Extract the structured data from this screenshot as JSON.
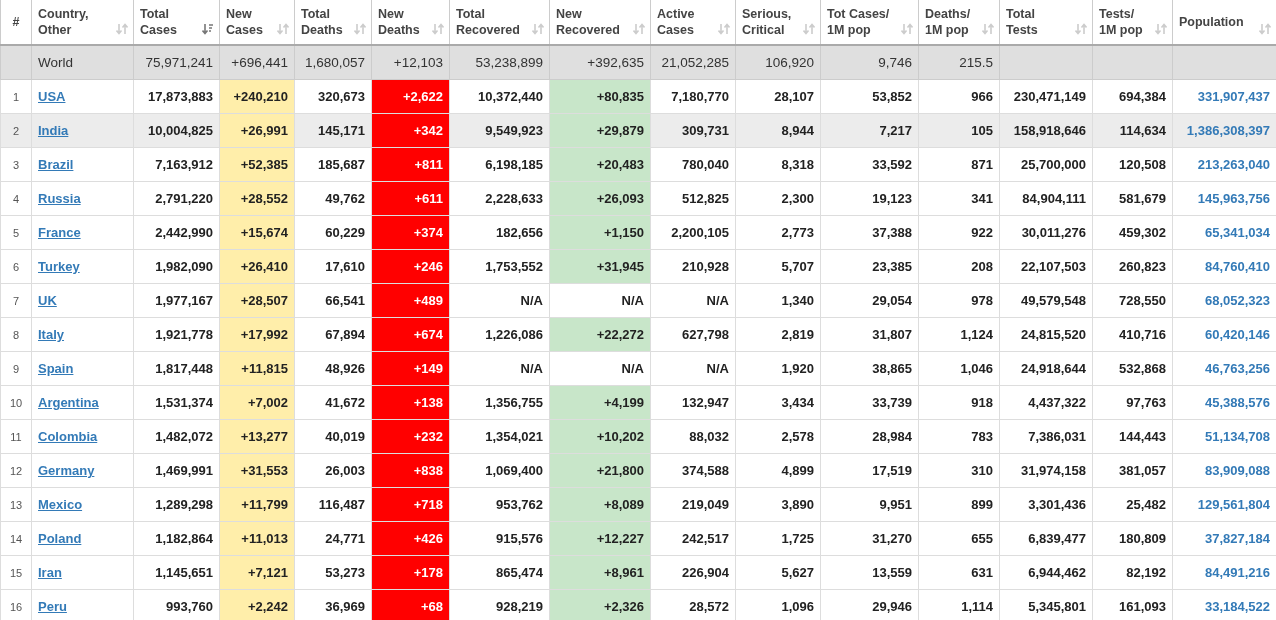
{
  "columns": [
    {
      "label": "#",
      "sortable": false
    },
    {
      "label": "Country,\nOther",
      "sortable": true,
      "sorted": false
    },
    {
      "label": "Total\nCases",
      "sortable": true,
      "sorted": true
    },
    {
      "label": "New\nCases",
      "sortable": true,
      "sorted": false,
      "color": "#ffeeaa"
    },
    {
      "label": "Total\nDeaths",
      "sortable": true,
      "sorted": false
    },
    {
      "label": "New\nDeaths",
      "sortable": true,
      "sorted": false,
      "color": "#ff0000"
    },
    {
      "label": "Total\nRecovered",
      "sortable": true,
      "sorted": false
    },
    {
      "label": "New\nRecovered",
      "sortable": true,
      "sorted": false,
      "color": "#c8e6c9"
    },
    {
      "label": "Active\nCases",
      "sortable": true,
      "sorted": false
    },
    {
      "label": "Serious,\nCritical",
      "sortable": true,
      "sorted": false
    },
    {
      "label": "Tot Cases/\n1M pop",
      "sortable": true,
      "sorted": false
    },
    {
      "label": "Deaths/\n1M pop",
      "sortable": true,
      "sorted": false
    },
    {
      "label": "Total\nTests",
      "sortable": true,
      "sorted": false
    },
    {
      "label": "Tests/\n1M pop",
      "sortable": true,
      "sorted": false
    },
    {
      "label": "Population",
      "sortable": true,
      "sorted": false
    }
  ],
  "world": {
    "label": "World",
    "values": [
      "75,971,241",
      "+696,441",
      "1,680,057",
      "+12,103",
      "53,238,899",
      "+392,635",
      "21,052,285",
      "106,920",
      "9,746",
      "215.5"
    ]
  },
  "rows": [
    {
      "rank": "1",
      "country": "USA",
      "selected": false,
      "recovered_reported": true,
      "values": [
        "17,873,883",
        "+240,210",
        "320,673",
        "+2,622",
        "10,372,440",
        "+80,835",
        "7,180,770",
        "28,107",
        "53,852",
        "966",
        "230,471,149",
        "694,384"
      ],
      "population": "331,907,437"
    },
    {
      "rank": "2",
      "country": "India",
      "selected": true,
      "recovered_reported": true,
      "values": [
        "10,004,825",
        "+26,991",
        "145,171",
        "+342",
        "9,549,923",
        "+29,879",
        "309,731",
        "8,944",
        "7,217",
        "105",
        "158,918,646",
        "114,634"
      ],
      "population": "1,386,308,397"
    },
    {
      "rank": "3",
      "country": "Brazil",
      "selected": false,
      "recovered_reported": true,
      "values": [
        "7,163,912",
        "+52,385",
        "185,687",
        "+811",
        "6,198,185",
        "+20,483",
        "780,040",
        "8,318",
        "33,592",
        "871",
        "25,700,000",
        "120,508"
      ],
      "population": "213,263,040"
    },
    {
      "rank": "4",
      "country": "Russia",
      "selected": false,
      "recovered_reported": true,
      "values": [
        "2,791,220",
        "+28,552",
        "49,762",
        "+611",
        "2,228,633",
        "+26,093",
        "512,825",
        "2,300",
        "19,123",
        "341",
        "84,904,111",
        "581,679"
      ],
      "population": "145,963,756"
    },
    {
      "rank": "5",
      "country": "France",
      "selected": false,
      "recovered_reported": true,
      "values": [
        "2,442,990",
        "+15,674",
        "60,229",
        "+374",
        "182,656",
        "+1,150",
        "2,200,105",
        "2,773",
        "37,388",
        "922",
        "30,011,276",
        "459,302"
      ],
      "population": "65,341,034"
    },
    {
      "rank": "6",
      "country": "Turkey",
      "selected": false,
      "recovered_reported": true,
      "values": [
        "1,982,090",
        "+26,410",
        "17,610",
        "+246",
        "1,753,552",
        "+31,945",
        "210,928",
        "5,707",
        "23,385",
        "208",
        "22,107,503",
        "260,823"
      ],
      "population": "84,760,410"
    },
    {
      "rank": "7",
      "country": "UK",
      "selected": false,
      "recovered_reported": false,
      "values": [
        "1,977,167",
        "+28,507",
        "66,541",
        "+489",
        "N/A",
        "N/A",
        "N/A",
        "1,340",
        "29,054",
        "978",
        "49,579,548",
        "728,550"
      ],
      "population": "68,052,323"
    },
    {
      "rank": "8",
      "country": "Italy",
      "selected": false,
      "recovered_reported": true,
      "values": [
        "1,921,778",
        "+17,992",
        "67,894",
        "+674",
        "1,226,086",
        "+22,272",
        "627,798",
        "2,819",
        "31,807",
        "1,124",
        "24,815,520",
        "410,716"
      ],
      "population": "60,420,146"
    },
    {
      "rank": "9",
      "country": "Spain",
      "selected": false,
      "recovered_reported": false,
      "values": [
        "1,817,448",
        "+11,815",
        "48,926",
        "+149",
        "N/A",
        "N/A",
        "N/A",
        "1,920",
        "38,865",
        "1,046",
        "24,918,644",
        "532,868"
      ],
      "population": "46,763,256"
    },
    {
      "rank": "10",
      "country": "Argentina",
      "selected": false,
      "recovered_reported": true,
      "values": [
        "1,531,374",
        "+7,002",
        "41,672",
        "+138",
        "1,356,755",
        "+4,199",
        "132,947",
        "3,434",
        "33,739",
        "918",
        "4,437,322",
        "97,763"
      ],
      "population": "45,388,576"
    },
    {
      "rank": "11",
      "country": "Colombia",
      "selected": false,
      "recovered_reported": true,
      "values": [
        "1,482,072",
        "+13,277",
        "40,019",
        "+232",
        "1,354,021",
        "+10,202",
        "88,032",
        "2,578",
        "28,984",
        "783",
        "7,386,031",
        "144,443"
      ],
      "population": "51,134,708"
    },
    {
      "rank": "12",
      "country": "Germany",
      "selected": false,
      "recovered_reported": true,
      "values": [
        "1,469,991",
        "+31,553",
        "26,003",
        "+838",
        "1,069,400",
        "+21,800",
        "374,588",
        "4,899",
        "17,519",
        "310",
        "31,974,158",
        "381,057"
      ],
      "population": "83,909,088"
    },
    {
      "rank": "13",
      "country": "Mexico",
      "selected": false,
      "recovered_reported": true,
      "values": [
        "1,289,298",
        "+11,799",
        "116,487",
        "+718",
        "953,762",
        "+8,089",
        "219,049",
        "3,890",
        "9,951",
        "899",
        "3,301,436",
        "25,482"
      ],
      "population": "129,561,804"
    },
    {
      "rank": "14",
      "country": "Poland",
      "selected": false,
      "recovered_reported": true,
      "values": [
        "1,182,864",
        "+11,013",
        "24,771",
        "+426",
        "915,576",
        "+12,227",
        "242,517",
        "1,725",
        "31,270",
        "655",
        "6,839,477",
        "180,809"
      ],
      "population": "37,827,184"
    },
    {
      "rank": "15",
      "country": "Iran",
      "selected": false,
      "recovered_reported": true,
      "values": [
        "1,145,651",
        "+7,121",
        "53,273",
        "+178",
        "865,474",
        "+8,961",
        "226,904",
        "5,627",
        "13,559",
        "631",
        "6,944,462",
        "82,192"
      ],
      "population": "84,491,216"
    },
    {
      "rank": "16",
      "country": "Peru",
      "selected": false,
      "recovered_reported": true,
      "values": [
        "993,760",
        "+2,242",
        "36,969",
        "+68",
        "928,219",
        "+2,326",
        "28,572",
        "1,096",
        "29,946",
        "1,114",
        "5,345,801",
        "161,093"
      ],
      "population": "33,184,522"
    }
  ]
}
